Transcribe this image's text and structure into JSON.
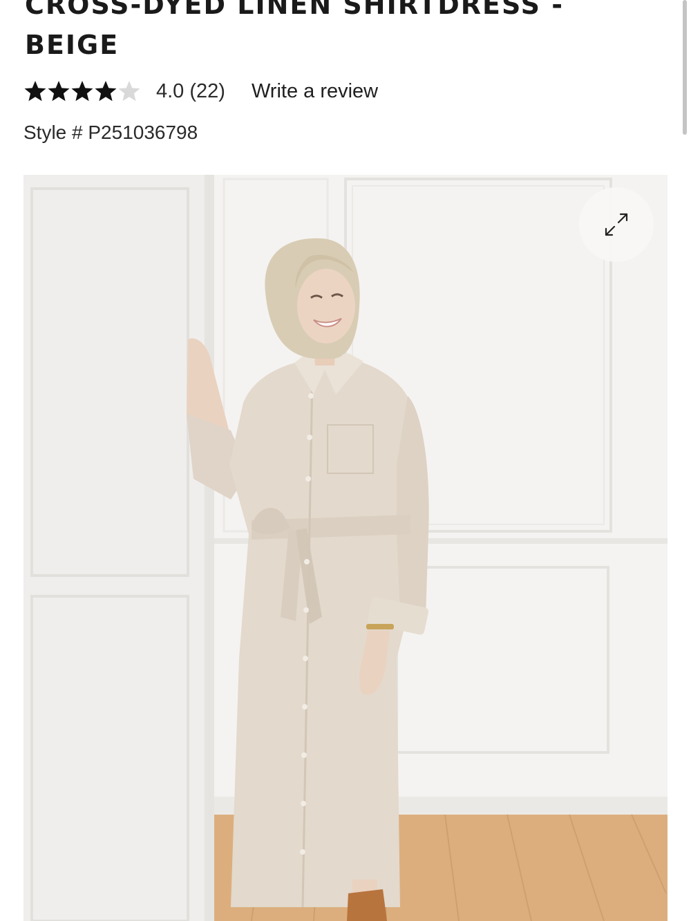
{
  "product": {
    "title_line1": "CROSS-DYED LINEN SHIRTDRESS -",
    "title_line2": "BEIGE",
    "rating": {
      "value": 4,
      "max": 5,
      "text": "4.0 (22)",
      "star_color": "#111111",
      "empty_star_color": "#d9d9d9"
    },
    "write_review_label": "Write a review",
    "style_number": "Style # P251036798"
  },
  "image": {
    "alt": "Model wearing the beige linen shirtdress",
    "expand_icon": "expand-arrows-icon",
    "colors": {
      "wall": "#f3f2f0",
      "floor": "#dcae7e",
      "dress": "#e3d9cc",
      "hair": "#d8ccb4"
    }
  }
}
